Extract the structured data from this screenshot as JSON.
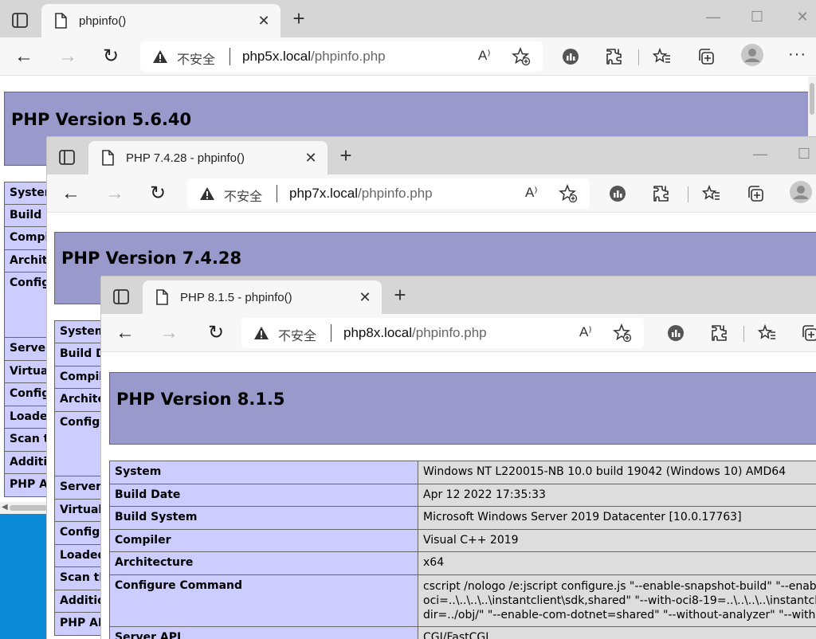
{
  "browser": {
    "insecure_label": "不安全",
    "aloud_label": "A⁾",
    "new_tab_glyph": "+",
    "close_glyph": "✕",
    "back_glyph": "←",
    "forward_glyph": "→",
    "reload_glyph": "↻",
    "more_glyph": "···",
    "minimize_glyph": "—",
    "maximize_glyph": "☐"
  },
  "windows": [
    {
      "tab_title": "phpinfo()",
      "url_host": "php5x.local",
      "url_path": "/phpinfo.php",
      "heading": "PHP Version 5.6.40",
      "rows": [
        "System",
        "Build Date",
        "Compiler",
        "Architecture",
        "Configure Command",
        "Server API",
        "Virtual Directory Support",
        "Configuration File (php.ini) Path",
        "Loaded Configuration File",
        "Scan this dir for additional .ini files",
        "Additional .ini files parsed",
        "PHP API"
      ]
    },
    {
      "tab_title": "PHP 7.4.28 - phpinfo()",
      "url_host": "php7x.local",
      "url_path": "/phpinfo.php",
      "heading": "PHP Version 7.4.28",
      "rows": [
        "System",
        "Build Date",
        "Compiler",
        "Architecture",
        "Configure Command",
        "Server API",
        "Virtual Directory Support",
        "Configuration File (php.ini) Path",
        "Loaded Configuration File",
        "Scan this dir for additional .ini files",
        "Additional .ini files parsed",
        "PHP API"
      ]
    },
    {
      "tab_title": "PHP 8.1.5 - phpinfo()",
      "url_host": "php8x.local",
      "url_path": "/phpinfo.php",
      "heading": "PHP Version 8.1.5",
      "rows": [
        {
          "key": "System",
          "value": [
            "Windows NT L220015-NB 10.0 build 19042 (Windows 10) AMD64"
          ]
        },
        {
          "key": "Build Date",
          "value": [
            "Apr 12 2022 17:35:33"
          ]
        },
        {
          "key": "Build System",
          "value": [
            "Microsoft Windows Server 2019 Datacenter [10.0.17763]"
          ]
        },
        {
          "key": "Compiler",
          "value": [
            "Visual C++ 2019"
          ]
        },
        {
          "key": "Architecture",
          "value": [
            "x64"
          ]
        },
        {
          "key": "Configure Command",
          "value": [
            "cscript /nologo /e:jscript configure.js \"--enable-snapshot-build\" \"--enable-de",
            "oci=..\\..\\..\\..\\instantclient\\sdk,shared\" \"--with-oci8-19=..\\..\\..\\..\\instantclient\\sc",
            "dir=../obj/\" \"--enable-com-dotnet=shared\" \"--without-analyzer\" \"--with-pgo\""
          ]
        },
        {
          "key": "Server API",
          "value": [
            "CGI/FastCGI"
          ]
        }
      ]
    }
  ]
}
